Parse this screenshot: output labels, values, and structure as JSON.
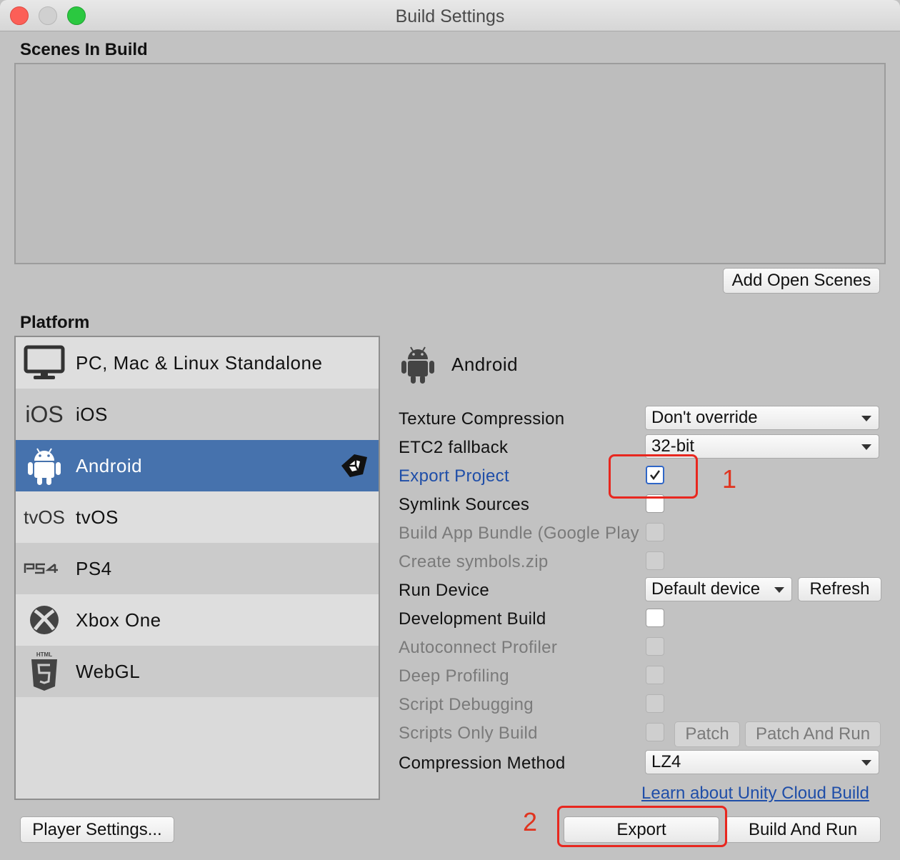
{
  "window": {
    "title": "Build Settings"
  },
  "scenes": {
    "label": "Scenes In Build",
    "add_button": "Add Open Scenes"
  },
  "platform": {
    "label": "Platform",
    "items": [
      {
        "label": "PC, Mac & Linux Standalone",
        "icon": "monitor-icon"
      },
      {
        "label": "iOS",
        "icon": "ios-logo",
        "logo_text": "iOS"
      },
      {
        "label": "Android",
        "icon": "android-icon",
        "selected": true
      },
      {
        "label": "tvOS",
        "icon": "tvos-logo",
        "logo_text": "tvOS"
      },
      {
        "label": "PS4",
        "icon": "ps4-logo",
        "logo_text": "PS4"
      },
      {
        "label": "Xbox One",
        "icon": "xbox-icon"
      },
      {
        "label": "WebGL",
        "icon": "html5-icon"
      }
    ]
  },
  "settings": {
    "header": "Android",
    "texture_compression": {
      "label": "Texture Compression",
      "value": "Don't override"
    },
    "etc2_fallback": {
      "label": "ETC2 fallback",
      "value": "32-bit"
    },
    "export_project": {
      "label": "Export Project",
      "checked": true
    },
    "symlink_sources": {
      "label": "Symlink Sources",
      "checked": false
    },
    "build_app_bundle": {
      "label": "Build App Bundle (Google Play",
      "checked": false
    },
    "create_symbols": {
      "label": "Create symbols.zip",
      "checked": false
    },
    "run_device": {
      "label": "Run Device",
      "value": "Default device",
      "refresh": "Refresh"
    },
    "development_build": {
      "label": "Development Build",
      "checked": false
    },
    "autoconnect_profiler": {
      "label": "Autoconnect Profiler"
    },
    "deep_profiling": {
      "label": "Deep Profiling"
    },
    "script_debugging": {
      "label": "Script Debugging"
    },
    "scripts_only_build": {
      "label": "Scripts Only Build",
      "patch": "Patch",
      "patch_and_run": "Patch And Run"
    },
    "compression_method": {
      "label": "Compression Method",
      "value": "LZ4"
    },
    "cloud_build_link": "Learn about Unity Cloud Build"
  },
  "footer": {
    "player_settings": "Player Settings...",
    "export": "Export",
    "build_and_run": "Build And Run"
  },
  "annotations": {
    "one": "1",
    "two": "2"
  },
  "colors": {
    "selection": "#4672ad",
    "annotation": "#e8271f",
    "link": "#1f4ea8"
  }
}
